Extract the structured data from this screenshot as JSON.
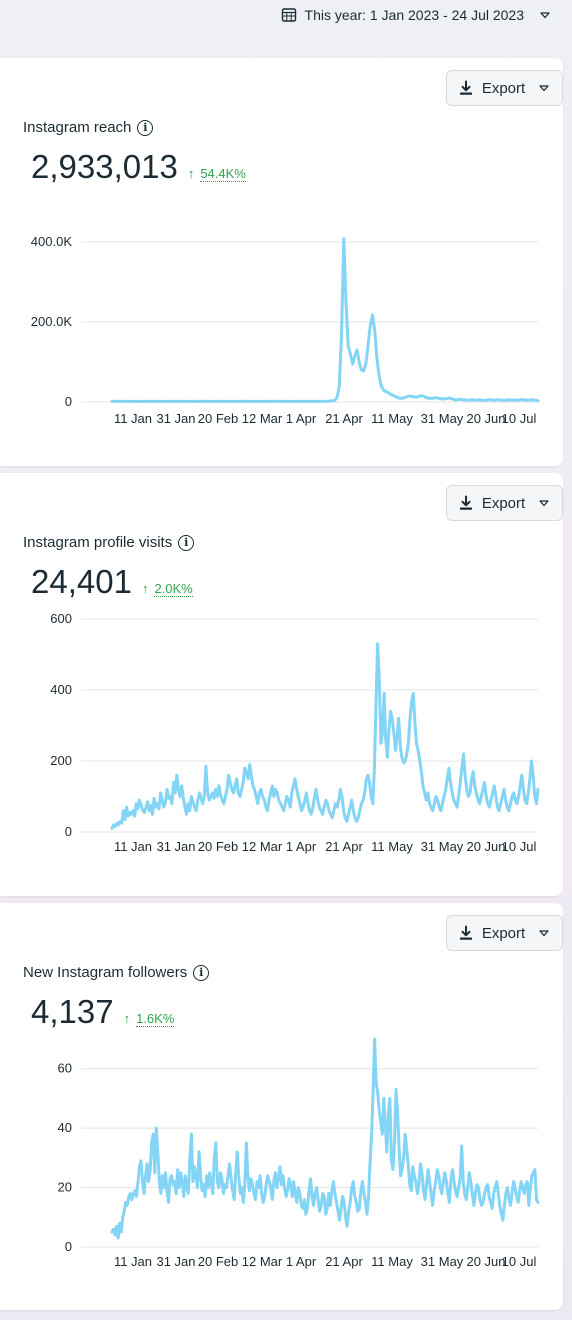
{
  "header": {
    "date_range": "This year: 1 Jan 2023 - 24 Jul 2023"
  },
  "export_label": "Export",
  "series_color": "#83d4f5",
  "cards": [
    {
      "title": "Instagram reach",
      "total": "2,933,013",
      "change": "54.4K%",
      "chart_data": {
        "type": "line",
        "x_labels": [
          "11 Jan",
          "31 Jan",
          "20 Feb",
          "12 Mar",
          "1 Apr",
          "21 Apr",
          "11 May",
          "31 May",
          "20 Jun",
          "10 Jul"
        ],
        "y_ticks": [
          "0",
          "200.0K",
          "400.0K"
        ],
        "ylim": [
          0,
          400000
        ],
        "grid": true,
        "values": [
          2000,
          1500,
          1800,
          1200,
          1600,
          1400,
          1700,
          1300,
          1500,
          1800,
          1200,
          1400,
          1600,
          1300,
          1500,
          1700,
          1200,
          1400,
          1600,
          1500,
          1300,
          1700,
          1400,
          1600,
          1200,
          1500,
          1800,
          1300,
          1400,
          1600,
          1700,
          1200,
          1500,
          1400,
          1600,
          1300,
          1800,
          1500,
          1200,
          1400,
          1600,
          1700,
          1300,
          1500,
          1400,
          1600,
          1200,
          1800,
          1500,
          1300,
          1700,
          1400,
          1600,
          1500,
          1300,
          1200,
          1600,
          1400,
          1700,
          1500,
          1800,
          1300,
          1400,
          1600,
          1200,
          1500,
          1700,
          1400,
          1300,
          1600,
          1500,
          1800,
          1200,
          1400,
          1700,
          1500,
          1600,
          1300,
          1400,
          1800,
          1500,
          1200,
          1600,
          1400,
          1700,
          1300,
          1500,
          1600,
          1400,
          1200,
          1800,
          1500,
          1700,
          1300,
          1600,
          1500,
          1400,
          1600,
          2000,
          2500,
          3000,
          4000,
          12000,
          40000,
          175000,
          408000,
          250000,
          140000,
          120000,
          95000,
          115000,
          130000,
          100000,
          80000,
          78000,
          95000,
          140000,
          190000,
          218000,
          180000,
          110000,
          65000,
          40000,
          30000,
          26000,
          24000,
          20000,
          17000,
          15000,
          12000,
          10000,
          9000,
          10000,
          12000,
          14000,
          15000,
          14000,
          13000,
          12000,
          14000,
          16000,
          15000,
          12000,
          10000,
          9000,
          9500,
          10000,
          11000,
          9000,
          8000,
          7500,
          8000,
          9000,
          10000,
          8000,
          6000,
          5000,
          6000,
          7000,
          5500,
          5000,
          4500,
          5000,
          6000,
          5000,
          4500,
          5500,
          5000,
          4500,
          4000,
          5000,
          6000,
          5000,
          4500,
          5000,
          5500,
          5000,
          4500,
          4000,
          5000,
          5500,
          5000,
          4800,
          4500,
          5000,
          5500,
          6000,
          5000,
          4500,
          5000,
          5500,
          5000,
          4000,
          3000
        ]
      }
    },
    {
      "title": "Instagram profile visits",
      "total": "24,401",
      "change": "2.0K%",
      "chart_data": {
        "type": "line",
        "x_labels": [
          "11 Jan",
          "31 Jan",
          "20 Feb",
          "12 Mar",
          "1 Apr",
          "21 Apr",
          "11 May",
          "31 May",
          "20 Jun",
          "10 Jul"
        ],
        "y_ticks": [
          "0",
          "200",
          "400",
          "600"
        ],
        "ylim": [
          0,
          600
        ],
        "grid": true,
        "values": [
          10,
          20,
          15,
          25,
          20,
          30,
          25,
          60,
          35,
          70,
          45,
          55,
          50,
          60,
          45,
          80,
          65,
          90,
          75,
          60,
          55,
          70,
          85,
          60,
          75,
          50,
          95,
          70,
          80,
          65,
          110,
          90,
          70,
          85,
          120,
          95,
          100,
          80,
          140,
          110,
          160,
          120,
          100,
          130,
          95,
          70,
          50,
          80,
          60,
          100,
          85,
          70,
          60,
          90,
          110,
          95,
          80,
          100,
          185,
          110,
          90,
          100,
          110,
          95,
          120,
          100,
          130,
          105,
          90,
          80,
          100,
          120,
          160,
          140,
          120,
          110,
          130,
          150,
          110,
          100,
          120,
          140,
          180,
          170,
          150,
          190,
          160,
          130,
          120,
          100,
          80,
          110,
          120,
          100,
          90,
          70,
          60,
          90,
          110,
          130,
          100,
          120,
          110,
          90,
          80,
          70,
          60,
          80,
          100,
          90,
          70,
          110,
          130,
          150,
          120,
          100,
          80,
          60,
          70,
          90,
          110,
          80,
          60,
          50,
          70,
          100,
          120,
          90,
          70,
          60,
          50,
          70,
          90,
          80,
          60,
          50,
          40,
          60,
          80,
          70,
          90,
          120,
          100,
          60,
          40,
          30,
          50,
          70,
          90,
          60,
          40,
          30,
          40,
          60,
          80,
          90,
          110,
          150,
          160,
          140,
          100,
          80,
          180,
          360,
          530,
          430,
          250,
          280,
          390,
          260,
          210,
          290,
          340,
          320,
          280,
          230,
          270,
          320,
          240,
          210,
          195,
          200,
          220,
          250,
          320,
          370,
          390,
          310,
          250,
          230,
          200,
          170,
          130,
          110,
          90,
          110,
          80,
          70,
          60,
          80,
          100,
          90,
          70,
          60,
          80,
          100,
          120,
          150,
          180,
          140,
          110,
          90,
          80,
          70,
          100,
          140,
          180,
          220,
          160,
          120,
          100,
          110,
          150,
          170,
          130,
          110,
          90,
          80,
          100,
          120,
          140,
          100,
          80,
          70,
          90,
          110,
          130,
          100,
          70,
          60,
          80,
          100,
          120,
          90,
          70,
          60,
          80,
          100,
          110,
          90,
          80,
          100,
          130,
          160,
          120,
          90,
          80,
          110,
          150,
          200,
          160,
          100,
          80,
          120
        ]
      }
    },
    {
      "title": "New Instagram followers",
      "total": "4,137",
      "change": "1.6K%",
      "chart_data": {
        "type": "line",
        "x_labels": [
          "11 Jan",
          "31 Jan",
          "20 Feb",
          "12 Mar",
          "1 Apr",
          "21 Apr",
          "11 May",
          "31 May",
          "20 Jun",
          "10 Jul"
        ],
        "y_ticks": [
          "0",
          "20",
          "40",
          "60"
        ],
        "ylim": [
          0,
          70
        ],
        "grid": true,
        "values": [
          5,
          6,
          4,
          7,
          3,
          8,
          5,
          10,
          12,
          15,
          14,
          17,
          18,
          16,
          18,
          19,
          17,
          22,
          27,
          29,
          22,
          18,
          24,
          28,
          22,
          26,
          35,
          38,
          25,
          40,
          32,
          22,
          18,
          24,
          20,
          25,
          19,
          15,
          23,
          24,
          21,
          22,
          18,
          26,
          20,
          25,
          22,
          17,
          24,
          20,
          18,
          30,
          38,
          22,
          27,
          24,
          20,
          32,
          24,
          19,
          21,
          17,
          24,
          20,
          25,
          22,
          18,
          30,
          35,
          22,
          20,
          25,
          23,
          18,
          21,
          20,
          24,
          28,
          23,
          19,
          16,
          25,
          32,
          24,
          18,
          20,
          15,
          21,
          35,
          24,
          19,
          23,
          21,
          18,
          16,
          22,
          20,
          24,
          18,
          15,
          17,
          21,
          24,
          22,
          20,
          16,
          22,
          25,
          20,
          23,
          27,
          21,
          24,
          20,
          17,
          19,
          23,
          21,
          17,
          22,
          18,
          15,
          20,
          18,
          14,
          13,
          16,
          11,
          13,
          19,
          23,
          17,
          14,
          18,
          20,
          16,
          12,
          14,
          18,
          17,
          11,
          13,
          18,
          14,
          19,
          22,
          18,
          15,
          12,
          9,
          13,
          17,
          15,
          10,
          7,
          12,
          15,
          20,
          22,
          17,
          15,
          12,
          13,
          19,
          22,
          18,
          15,
          11,
          17,
          28,
          38,
          52,
          70,
          55,
          52,
          46,
          42,
          38,
          50,
          41,
          32,
          45,
          50,
          29,
          26,
          35,
          53,
          46,
          33,
          24,
          26,
          30,
          38,
          33,
          28,
          21,
          19,
          27,
          24,
          22,
          18,
          21,
          28,
          25,
          19,
          16,
          21,
          26,
          22,
          18,
          14,
          19,
          22,
          26,
          24,
          20,
          18,
          22,
          25,
          22,
          18,
          15,
          23,
          26,
          22,
          19,
          17,
          20,
          23,
          34,
          22,
          18,
          16,
          20,
          25,
          22,
          18,
          14,
          18,
          21,
          20,
          16,
          14,
          15,
          18,
          20,
          21,
          17,
          15,
          13,
          18,
          20,
          22,
          18,
          14,
          11,
          9,
          14,
          18,
          20,
          16,
          14,
          18,
          22,
          20,
          17,
          15,
          19,
          22,
          20,
          18,
          21,
          22,
          14,
          20,
          24,
          25,
          26,
          16,
          15
        ]
      }
    }
  ]
}
